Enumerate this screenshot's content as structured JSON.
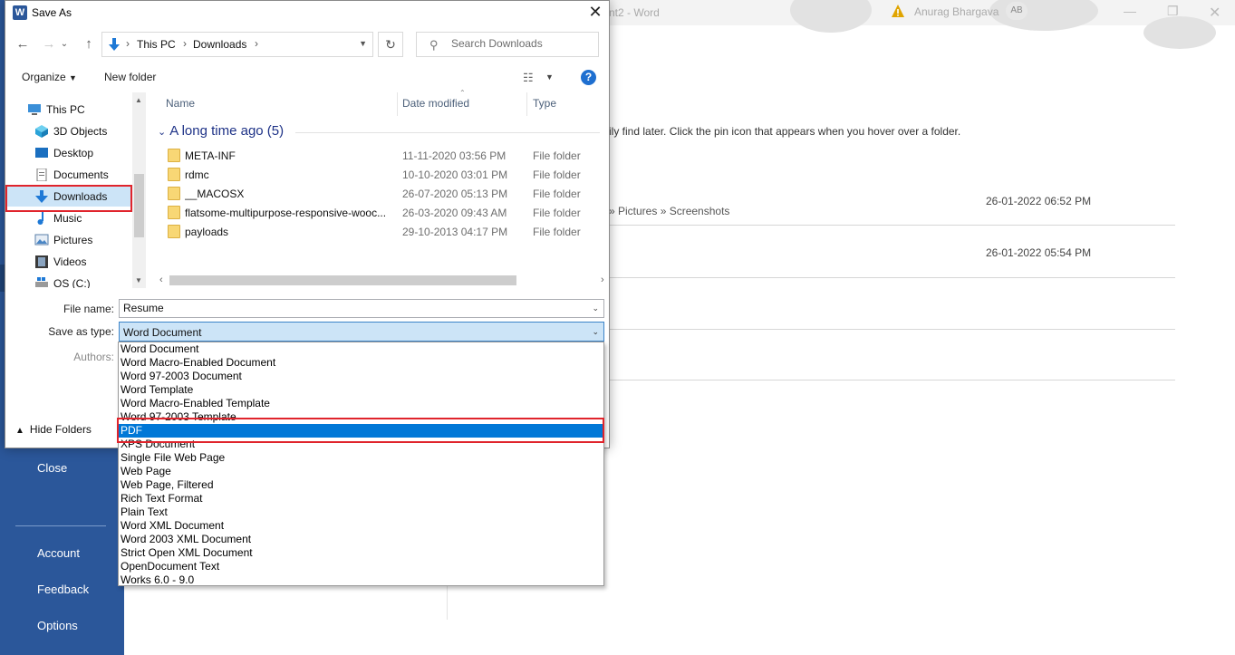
{
  "word": {
    "title_fragment": "nt2 - Word",
    "user_name": "Anurag Bhargava",
    "user_initials": "AB",
    "hint_text": "ily find later. Click the pin icon that appears when you hover over a folder.",
    "recent_path": "» Pictures » Screenshots",
    "recent_dates": [
      "26-01-2022 06:52 PM",
      "26-01-2022 05:54 PM"
    ],
    "left_nav": [
      "Close",
      "Account",
      "Feedback",
      "Options"
    ]
  },
  "dialog": {
    "title": "Save As",
    "app_icon_letter": "W",
    "breadcrumb": [
      "This PC",
      "Downloads"
    ],
    "search_placeholder": "Search Downloads",
    "organize_label": "Organize",
    "new_folder_label": "New folder",
    "help_label": "?",
    "nav_items": [
      {
        "label": "This PC",
        "icon": "pc-icon"
      },
      {
        "label": "3D Objects",
        "icon": "3d-objects-icon"
      },
      {
        "label": "Desktop",
        "icon": "desktop-icon"
      },
      {
        "label": "Documents",
        "icon": "documents-icon"
      },
      {
        "label": "Downloads",
        "icon": "downloads-icon"
      },
      {
        "label": "Music",
        "icon": "music-icon"
      },
      {
        "label": "Pictures",
        "icon": "pictures-icon"
      },
      {
        "label": "Videos",
        "icon": "videos-icon"
      },
      {
        "label": "OS (C:)",
        "icon": "drive-icon"
      }
    ],
    "columns": [
      "Name",
      "Date modified",
      "Type"
    ],
    "group_label": "A long time ago (5)",
    "files": [
      {
        "name": "META-INF",
        "date": "11-11-2020 03:56 PM",
        "type": "File folder"
      },
      {
        "name": "rdmc",
        "date": "10-10-2020 03:01 PM",
        "type": "File folder"
      },
      {
        "name": "__MACOSX",
        "date": "26-07-2020 05:13 PM",
        "type": "File folder"
      },
      {
        "name": "flatsome-multipurpose-responsive-wooc...",
        "date": "26-03-2020 09:43 AM",
        "type": "File folder"
      },
      {
        "name": "payloads",
        "date": "29-10-2013 04:17 PM",
        "type": "File folder"
      }
    ],
    "file_name_label": "File name:",
    "file_name_value": "Resume",
    "save_type_label": "Save as type:",
    "save_type_value": "Word Document",
    "authors_label": "Authors:",
    "hide_folders_label": "Hide Folders",
    "type_options": [
      "Word Document",
      "Word Macro-Enabled Document",
      "Word 97-2003 Document",
      "Word Template",
      "Word Macro-Enabled Template",
      "Word 97-2003 Template",
      "PDF",
      "XPS Document",
      "Single File Web Page",
      "Web Page",
      "Web Page, Filtered",
      "Rich Text Format",
      "Plain Text",
      "Word XML Document",
      "Word 2003 XML Document",
      "Strict Open XML Document",
      "OpenDocument Text",
      "Works 6.0 - 9.0"
    ],
    "selected_option_index": 6,
    "highlight_color": "#e0242c",
    "accent_color": "#0078d7"
  }
}
